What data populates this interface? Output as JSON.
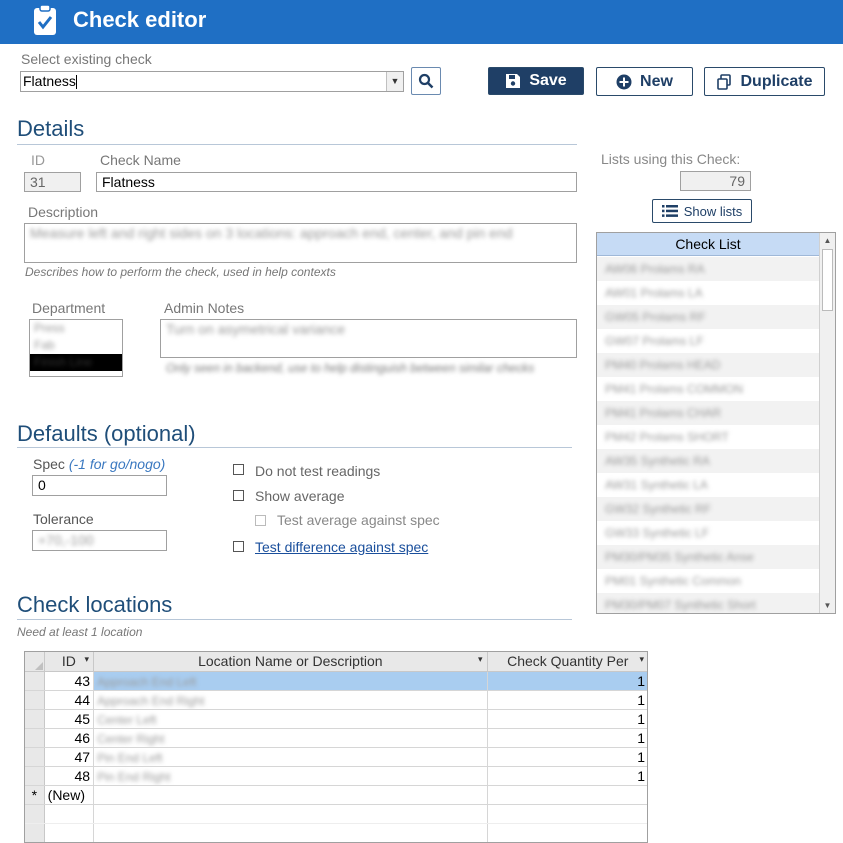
{
  "app": {
    "title": "Check editor"
  },
  "selector": {
    "label": "Select existing check",
    "value": "Flatness"
  },
  "toolbar": {
    "save_label": "Save",
    "new_label": "New",
    "duplicate_label": "Duplicate"
  },
  "details": {
    "section_title": "Details",
    "id_label": "ID",
    "id_value": "31",
    "name_label": "Check Name",
    "name_value": "Flatness",
    "description_label": "Description",
    "description_value": "Measure left and right sides on 3 locations: approach end, center, and pin end",
    "description_hint": "Describes how to perform the check, used in help contexts",
    "department_label": "Department",
    "departments": [
      "Press",
      "Fab",
      "Finish Line"
    ],
    "admin_notes_label": "Admin Notes",
    "admin_notes_value": "Turn on asymetrical variance",
    "admin_notes_hint": "Only seen in backend, use to help distinguish between similar checks"
  },
  "lists_panel": {
    "label": "Lists using this Check:",
    "count": "79",
    "show_lists_label": "Show lists",
    "header": "Check List",
    "items": [
      "AW06 Prolams RA",
      "AW01 Prolams LA",
      "GW05 Prolams RF",
      "GW07 Prolams LF",
      "PM40 Prolams HEAD",
      "PM41 Prolams COMMON",
      "PM41 Prolams CHAR",
      "PM42 Prolams SHORT",
      "AW35 Synthetic RA",
      "AW31 Synthetic LA",
      "GW32 Synthetic RF",
      "GW33 Synthetic LF",
      "PM30/PM35 Synthetic Anse",
      "PM01 Synthetic Common",
      "PM30/PM07 Synthetic Short"
    ]
  },
  "defaults": {
    "section_title": "Defaults (optional)",
    "spec_label": "Spec",
    "spec_note": "(-1 for go/nogo)",
    "spec_value": "0",
    "tolerance_label": "Tolerance",
    "tolerance_value": "+70,-100",
    "do_not_test_label": "Do not test readings",
    "show_average_label": "Show average",
    "test_average_label": "Test average against spec",
    "test_difference_label": "Test difference against spec"
  },
  "locations": {
    "section_title": "Check locations",
    "hint": "Need at least 1 location",
    "columns": [
      "ID",
      "Location Name or Description",
      "Check Quantity Per"
    ],
    "rows": [
      {
        "id": "43",
        "name": "Approach End Left",
        "qty": "1"
      },
      {
        "id": "44",
        "name": "Approach End Right",
        "qty": "1"
      },
      {
        "id": "45",
        "name": "Center Left",
        "qty": "1"
      },
      {
        "id": "46",
        "name": "Center Right",
        "qty": "1"
      },
      {
        "id": "47",
        "name": "Pin End Left",
        "qty": "1"
      },
      {
        "id": "48",
        "name": "Pin End Right",
        "qty": "1"
      }
    ],
    "new_row_marker": "*",
    "new_row_label": "(New)"
  },
  "icons": [
    "clipboard-check-icon",
    "search-icon",
    "save-icon",
    "plus-circle-icon",
    "duplicate-icon",
    "list-icon"
  ],
  "colors": {
    "title_bar": "#1f6fc4",
    "primary_button": "#1f3f66",
    "section_title": "#1f4e79",
    "list_header": "#c6dbf5",
    "row_selected": "#a9cdf0"
  }
}
